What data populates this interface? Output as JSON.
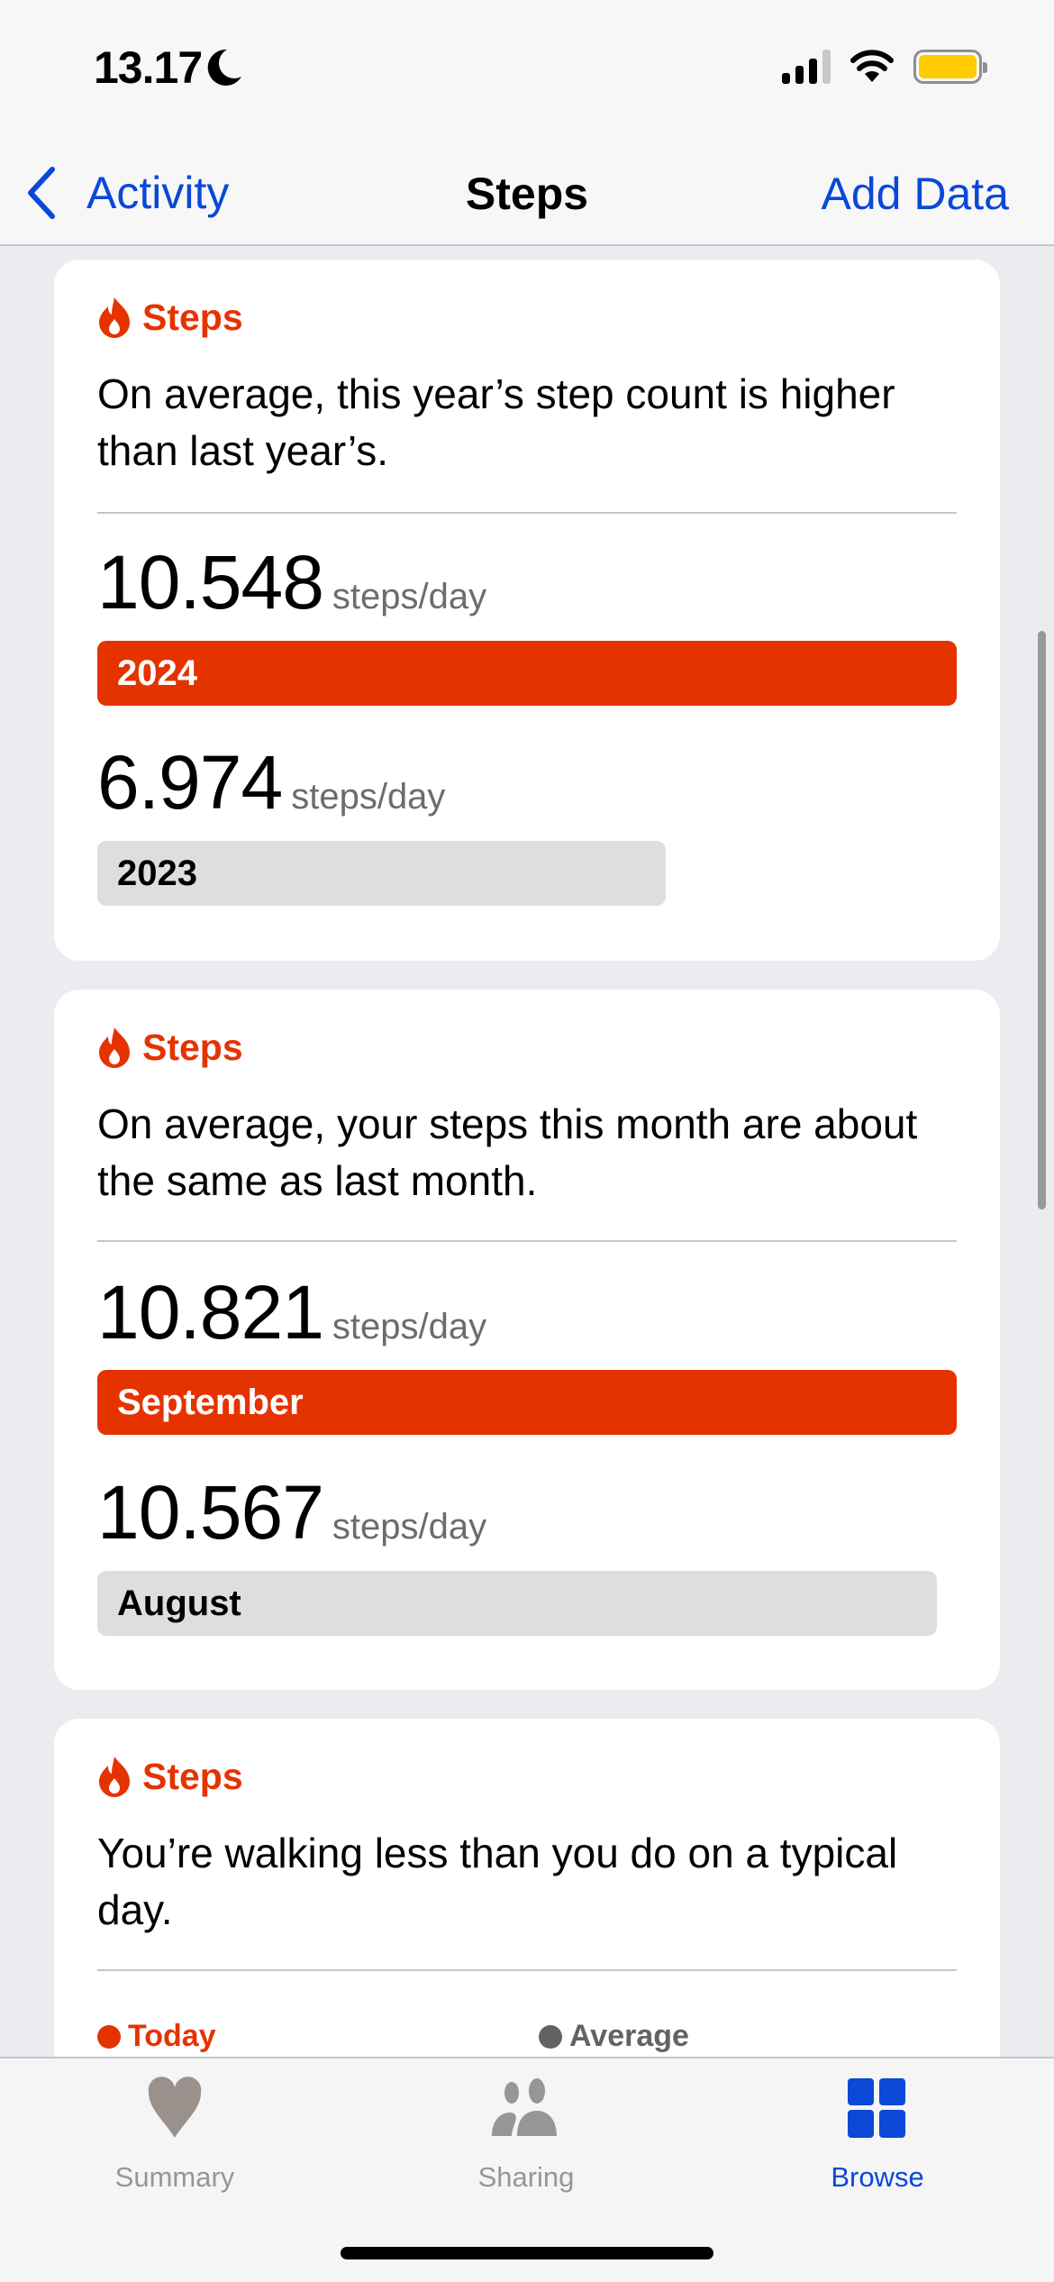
{
  "status_bar": {
    "time": "13.17",
    "focus_icon": "moon-icon",
    "signal_bars_active": 3,
    "signal_bars_total": 4,
    "wifi_icon": "wifi-icon",
    "battery_color": "#ffcc00"
  },
  "nav": {
    "back_label": "Activity",
    "title": "Steps",
    "action_label": "Add Data"
  },
  "colors": {
    "accent": "#e53300",
    "link": "#0a48d8",
    "secondary_bar": "#dedee1"
  },
  "cards": [
    {
      "category": "Steps",
      "headline": "On average, this year’s step count is higher than last year’s.",
      "metrics": [
        {
          "value": "10.548",
          "unit": "steps/day",
          "label": "2024",
          "fraction": 1.0
        },
        {
          "value": "6.974",
          "unit": "steps/day",
          "label": "2023",
          "fraction": 0.661
        }
      ]
    },
    {
      "category": "Steps",
      "headline": "On average, your steps this month are about the same as last month.",
      "metrics": [
        {
          "value": "10.821",
          "unit": "steps/day",
          "label": "September",
          "fraction": 1.0
        },
        {
          "value": "10.567",
          "unit": "steps/day",
          "label": "August",
          "fraction": 0.977
        }
      ]
    },
    {
      "category": "Steps",
      "headline": "You’re walking less than you do on a typical day.",
      "legend": [
        {
          "label": "Today",
          "color": "#e53300"
        },
        {
          "label": "Average",
          "color": "#636366"
        }
      ]
    }
  ],
  "tab_bar": {
    "tabs": [
      {
        "label": "Summary",
        "icon": "heart-icon",
        "active": false
      },
      {
        "label": "Sharing",
        "icon": "people-icon",
        "active": false
      },
      {
        "label": "Browse",
        "icon": "grid-icon",
        "active": true
      }
    ]
  }
}
